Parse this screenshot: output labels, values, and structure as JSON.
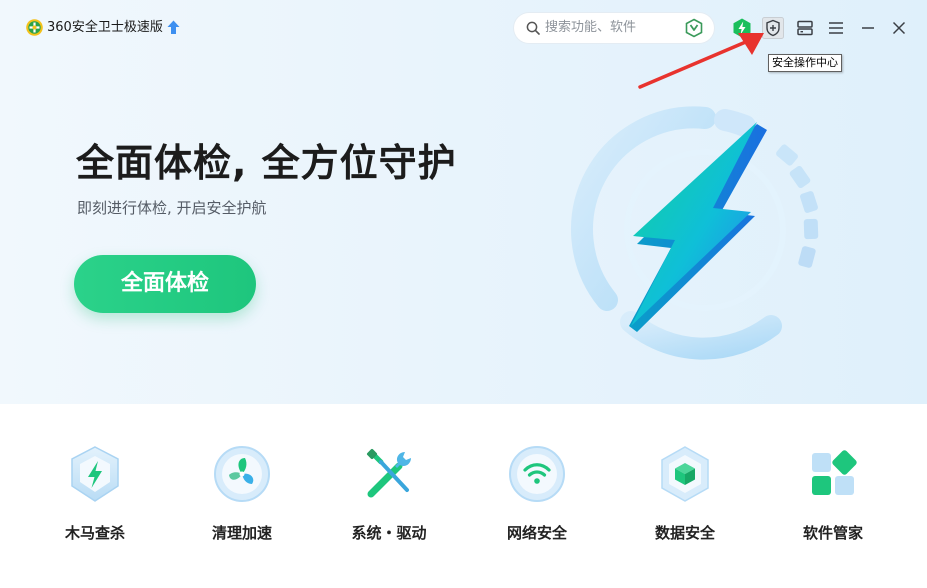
{
  "app": {
    "title": "360安全卫士极速版",
    "logo_icon": "360-logo-icon",
    "upgrade_icon": "upgrade-arrow-icon"
  },
  "search": {
    "placeholder": "搜索功能、软件"
  },
  "titlebar": {
    "icons": [
      "search-icon",
      "scan-shield-icon",
      "speed-boost-icon",
      "security-center-icon",
      "skin-icon",
      "menu-icon",
      "minimize-icon",
      "close-icon"
    ],
    "tooltip": "安全操作中心"
  },
  "hero": {
    "title": "全面体检, 全方位守护",
    "subtitle": "即刻进行体检, 开启安全护航",
    "button_label": "全面体检"
  },
  "tools": [
    {
      "label": "木马查杀",
      "icon": "trojan-scan-icon"
    },
    {
      "label": "清理加速",
      "icon": "cleanup-fan-icon"
    },
    {
      "label": "系统・驱动",
      "icon": "wrench-screwdriver-icon"
    },
    {
      "label": "网络安全",
      "icon": "wifi-shield-icon"
    },
    {
      "label": "数据安全",
      "icon": "data-cube-icon"
    },
    {
      "label": "软件管家",
      "icon": "software-grid-icon"
    }
  ],
  "colors": {
    "accent_green": "#1ec67d",
    "annotation_red": "#e8332e",
    "hero_bg": "#e9f4fc"
  }
}
